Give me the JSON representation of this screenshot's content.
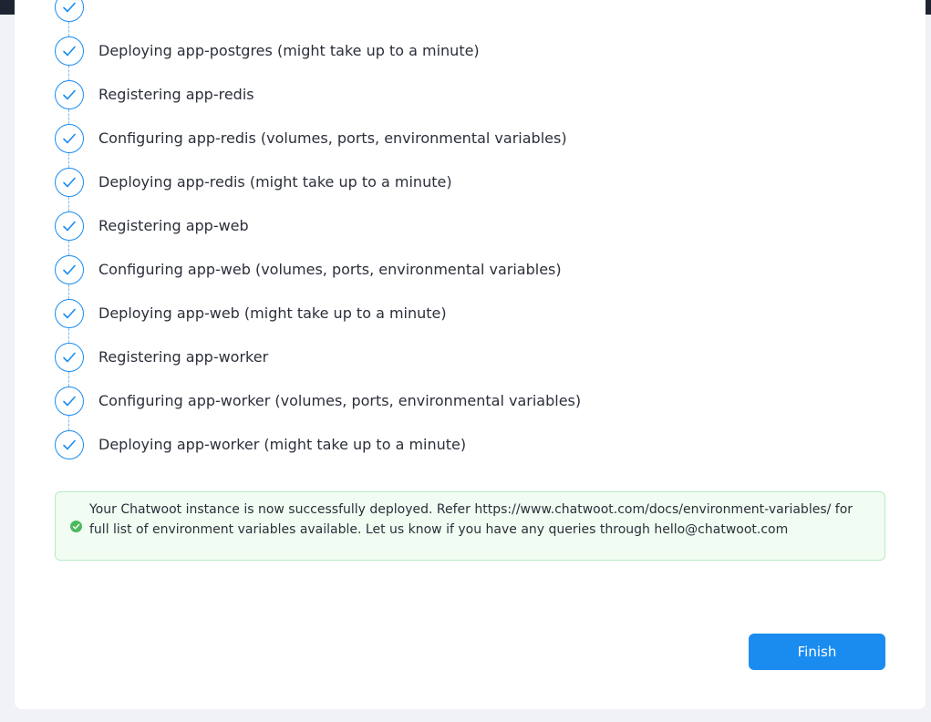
{
  "steps": [
    {
      "label": "",
      "icon": "check-icon"
    },
    {
      "label": "Deploying app-postgres (might take up to a minute)",
      "icon": "check-icon"
    },
    {
      "label": "Registering app-redis",
      "icon": "check-icon"
    },
    {
      "label": "Configuring app-redis (volumes, ports, environmental variables)",
      "icon": "check-icon"
    },
    {
      "label": "Deploying app-redis (might take up to a minute)",
      "icon": "check-icon"
    },
    {
      "label": "Registering app-web",
      "icon": "check-icon"
    },
    {
      "label": "Configuring app-web (volumes, ports, environmental variables)",
      "icon": "check-icon"
    },
    {
      "label": "Deploying app-web (might take up to a minute)",
      "icon": "check-icon"
    },
    {
      "label": "Registering app-worker",
      "icon": "check-icon"
    },
    {
      "label": "Configuring app-worker (volumes, ports, environmental variables)",
      "icon": "check-icon"
    },
    {
      "label": "Deploying app-worker (might take up to a minute)",
      "icon": "check-icon"
    }
  ],
  "alert": {
    "icon": "check-circle-icon",
    "message": "Your Chatwoot instance is now successfully deployed. Refer https://www.chatwoot.com/docs/environment-variables/ for full list of environment variables available. Let us know if you have any queries through hello@chatwoot.com"
  },
  "actions": {
    "finish_label": "Finish"
  },
  "colors": {
    "accent": "#1a8cf0",
    "success": "#4cb95d",
    "success_bg": "#f1fdf2"
  }
}
